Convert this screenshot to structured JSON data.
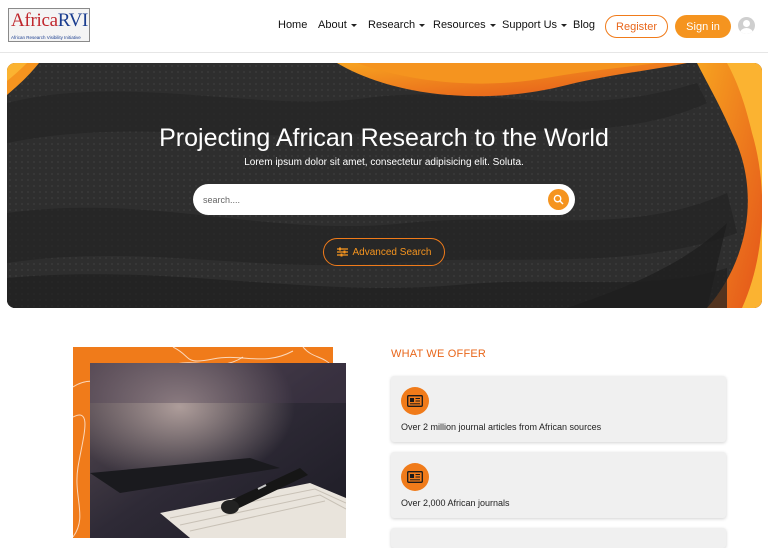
{
  "brand": {
    "logo_text_a": "Africa",
    "logo_text_b": "RVI",
    "logo_tagline": "African Research Visibility Initiative"
  },
  "nav": {
    "items": [
      {
        "label": "Home",
        "dropdown": false
      },
      {
        "label": "About",
        "dropdown": true
      },
      {
        "label": "Research",
        "dropdown": true
      },
      {
        "label": "Resources",
        "dropdown": true
      },
      {
        "label": "Support Us",
        "dropdown": true
      },
      {
        "label": "Blog",
        "dropdown": false
      }
    ],
    "register_label": "Register",
    "signin_label": "Sign in"
  },
  "hero": {
    "title": "Projecting African Research to the World",
    "subtitle": "Lorem ipsum dolor sit amet, consectetur adipisicing elit. Soluta.",
    "search_placeholder": "search....",
    "advanced_search_label": "Advanced Search"
  },
  "offer": {
    "heading": "WHAT WE OFFER",
    "cards": [
      {
        "icon": "newspaper-icon",
        "text": "Over 2 million journal articles from African sources"
      },
      {
        "icon": "newspaper-icon",
        "text": "Over 2,000 African journals"
      }
    ]
  },
  "colors": {
    "accent": "#f5941f",
    "accent_dark": "#e8661a",
    "hero_dark": "#2b2b2b"
  }
}
